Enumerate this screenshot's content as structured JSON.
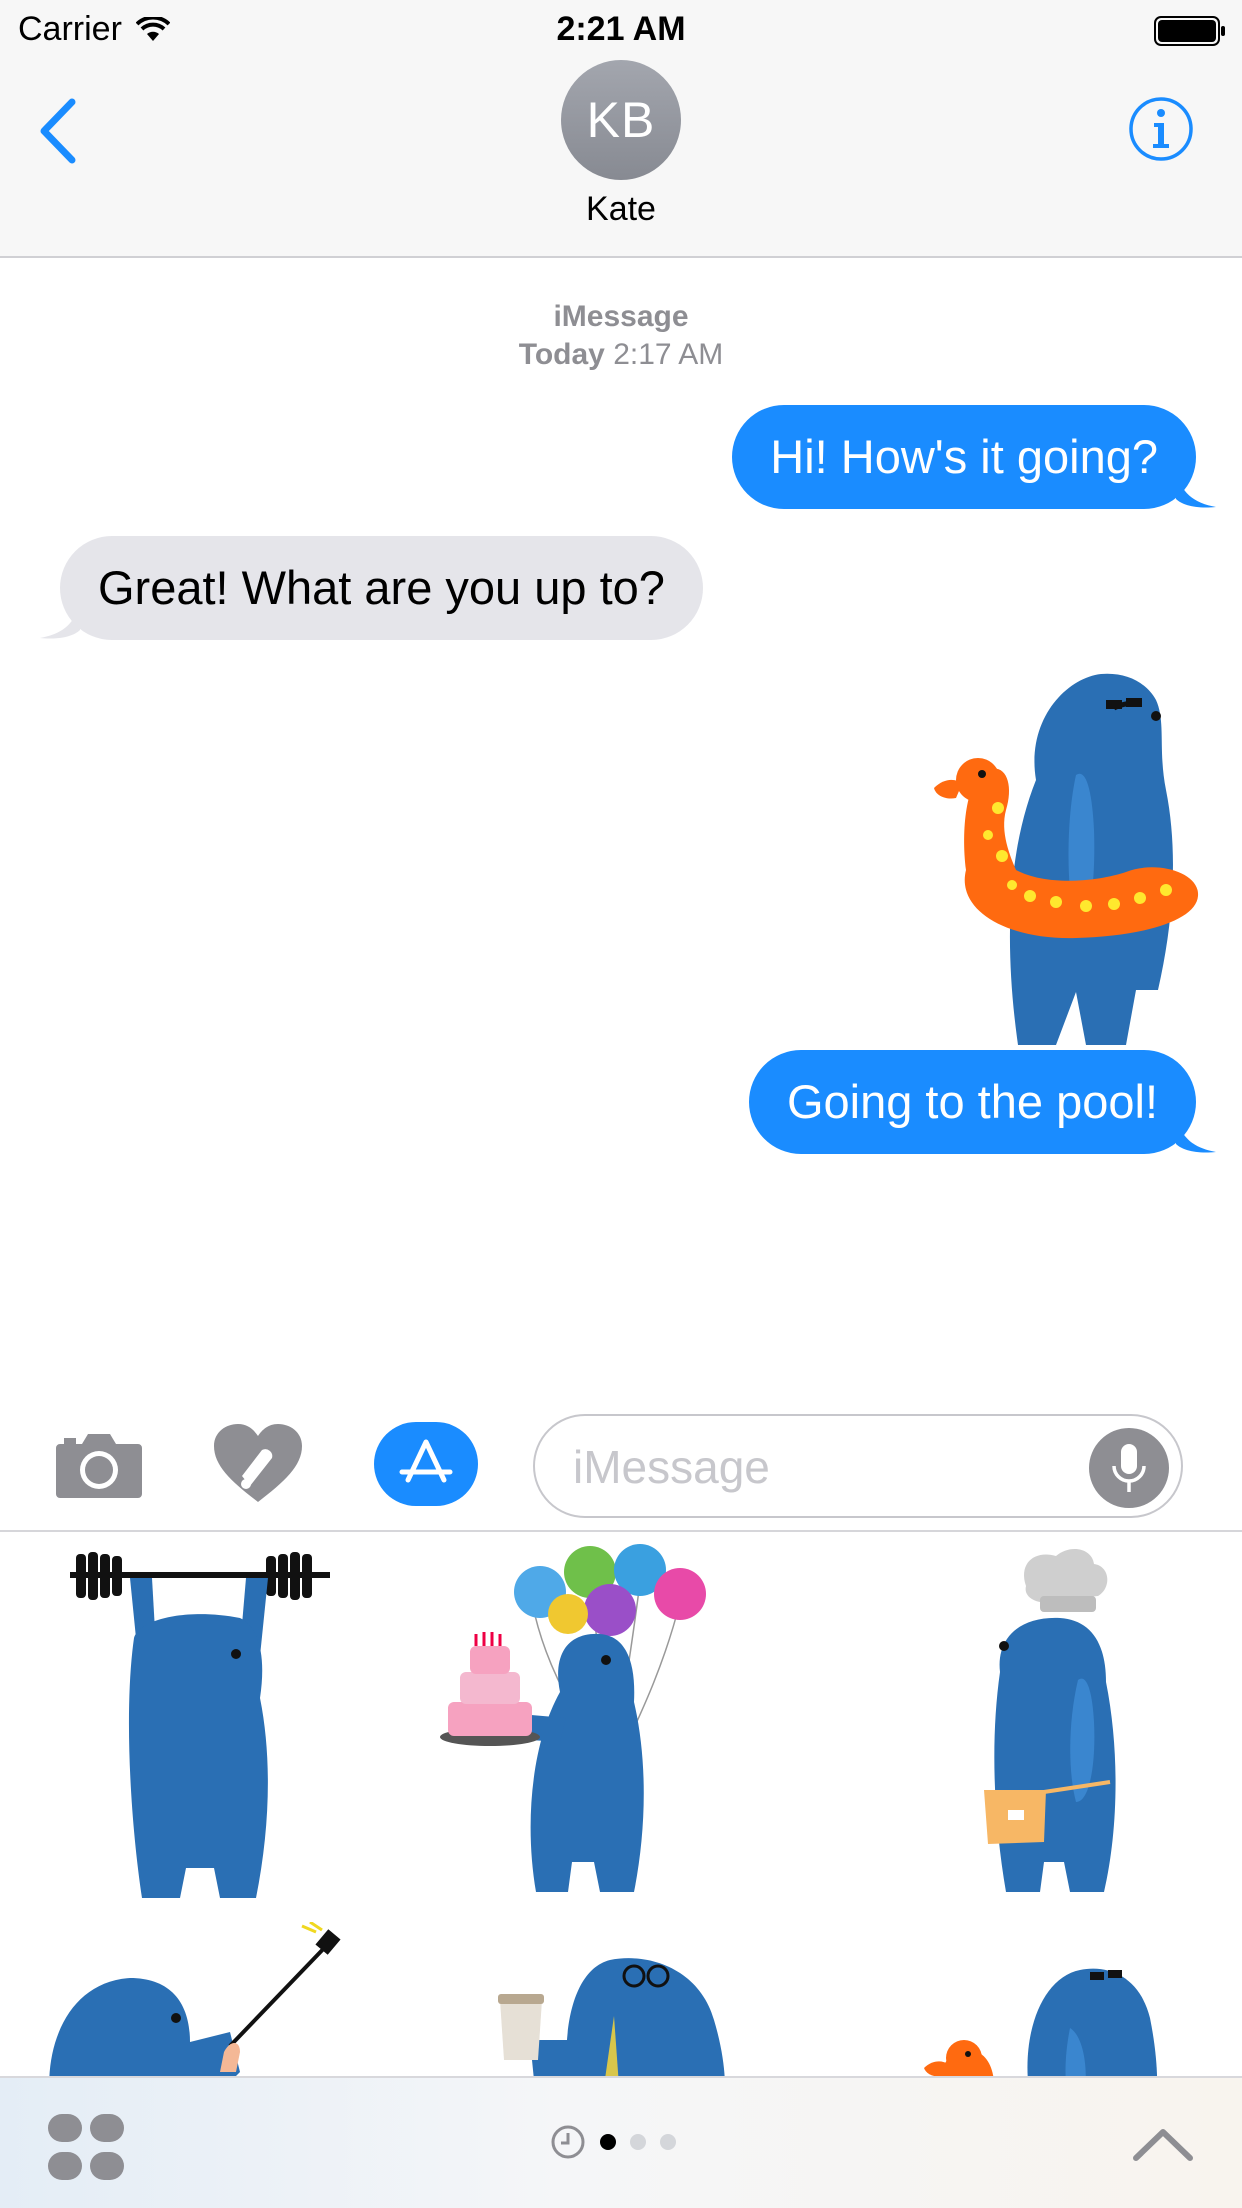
{
  "status_bar": {
    "carrier": "Carrier",
    "time": "2:21 AM"
  },
  "header": {
    "avatar_initials": "KB",
    "contact_name": "Kate",
    "back_icon": "chevron-left-icon",
    "info_icon": "info-icon"
  },
  "conversation": {
    "service": "iMessage",
    "day": "Today",
    "time": "2:17 AM",
    "messages": [
      {
        "direction": "outgoing",
        "text": "Hi! How's it going?"
      },
      {
        "direction": "incoming",
        "text": "Great! What are you up to?"
      },
      {
        "direction": "outgoing",
        "sticker": "bear-with-duck-float"
      },
      {
        "direction": "outgoing",
        "text": "Going to the pool!"
      }
    ]
  },
  "input": {
    "placeholder": "iMessage",
    "buttons": [
      "camera-icon",
      "digital-touch-icon",
      "app-store-icon",
      "microphone-icon"
    ]
  },
  "sticker_drawer": {
    "stickers": [
      "bear-weightlifting",
      "bear-with-cake-and-balloons",
      "bear-chef",
      "bear-selfie-stick",
      "bear-with-coffee-and-tie",
      "bear-with-duck-float"
    ]
  },
  "bottom_bar": {
    "page_count": 3,
    "current_page": 1
  },
  "colors": {
    "accent": "#1a8cff",
    "incoming_bubble": "#e5e5ea",
    "bear_blue": "#2a6fb4"
  }
}
